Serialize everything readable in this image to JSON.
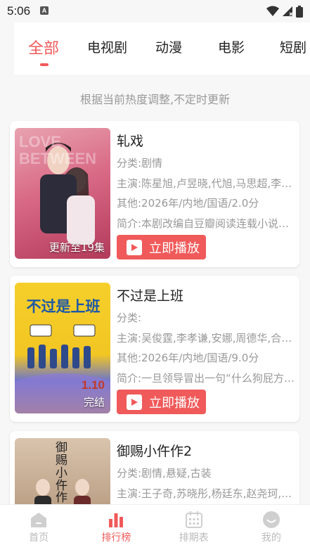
{
  "status_bar": {
    "time": "5:06",
    "notification": "A"
  },
  "tabs": [
    {
      "label": "全部",
      "active": true
    },
    {
      "label": "电视剧",
      "active": false
    },
    {
      "label": "动漫",
      "active": false
    },
    {
      "label": "电影",
      "active": false
    },
    {
      "label": "短剧",
      "active": false
    }
  ],
  "notice": "根据当前热度调整,不定时更新",
  "cards": [
    {
      "title": "轧戏",
      "category": "分类:剧情",
      "cast": "主演:陈星旭,卢昱晓,代旭,马思超,李…",
      "other": "其他:2026年/内地/国语/2.0分",
      "intro": "简介:本剧改编自豆瓣阅读连载小说…",
      "badge": "更新至19集",
      "poster_text": "LOVE BETWEEN",
      "play_label": "立即播放"
    },
    {
      "title": "不过是上班",
      "category": "分类:",
      "cast": "主演:吴俊霆,李孝谦,安娜,周德华,合…",
      "other": "其他:2026年/内地/国语/9.0分",
      "intro": "简介:一旦领导冒出一句“什么狗屁方…",
      "badge": "完结",
      "poster_text": "不过是上班",
      "poster_date": "1.10",
      "play_label": "立即播放"
    },
    {
      "title": "御赐小仵作2",
      "category": "分类:剧情,悬疑,古装",
      "cast": "主演:王子奇,苏晓彤,杨廷东,赵尧珂,…",
      "poster_text": "御赐小仵作"
    }
  ],
  "bottom_nav": [
    {
      "label": "首页",
      "icon": "home-icon",
      "active": false
    },
    {
      "label": "排行榜",
      "icon": "ranking-icon",
      "active": true
    },
    {
      "label": "排期表",
      "icon": "calendar-icon",
      "active": false
    },
    {
      "label": "我的",
      "icon": "profile-icon",
      "active": false
    }
  ],
  "colors": {
    "accent": "#f05a5a",
    "muted_text": "#999999",
    "background": "#f7f7f7"
  }
}
